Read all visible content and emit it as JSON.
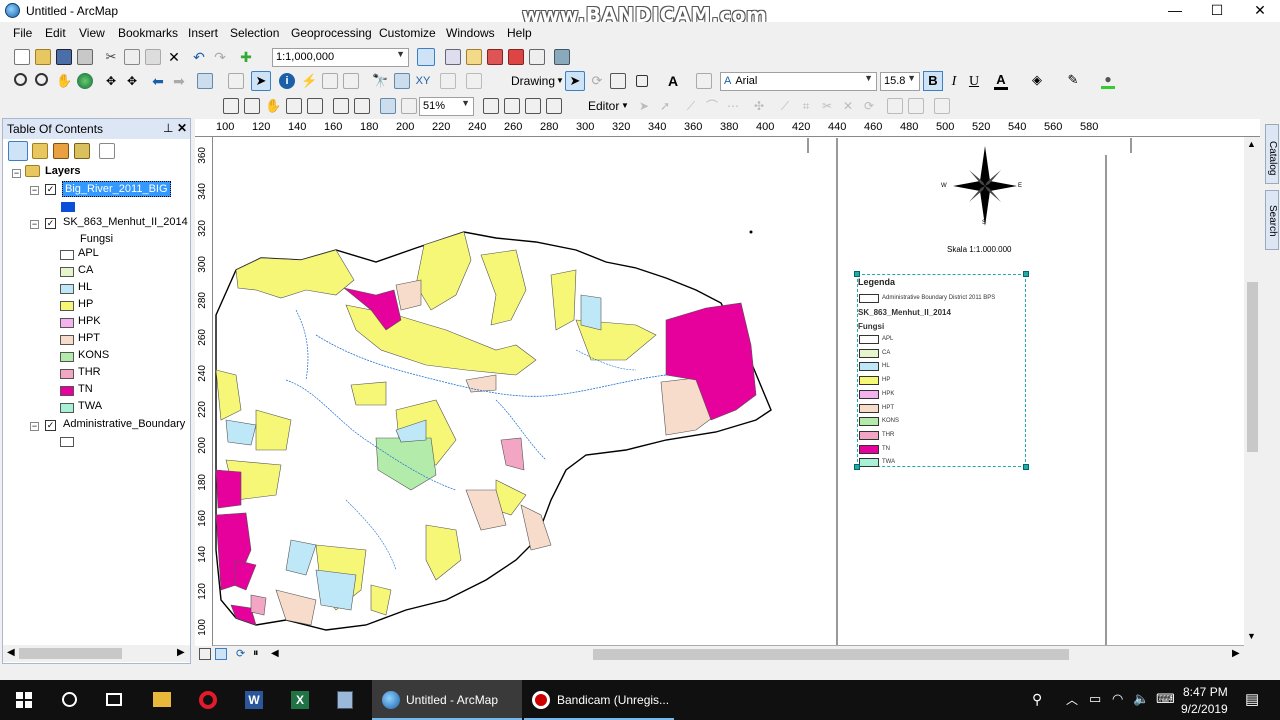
{
  "window": {
    "title": "Untitled - ArcMap",
    "watermark": "www.BANDICAM.com",
    "min": "—",
    "max": "☐",
    "close": "✕"
  },
  "menu": [
    "File",
    "Edit",
    "View",
    "Bookmarks",
    "Insert",
    "Selection",
    "Geoprocessing",
    "Customize",
    "Windows",
    "Help"
  ],
  "toolbar": {
    "scale": "1:1,000,000",
    "drawing_label": "Drawing",
    "font": "Arial",
    "font_size": "15.8",
    "bold": "B",
    "italic": "I",
    "underline": "U",
    "zoom": "51%",
    "editor": "Editor"
  },
  "toc": {
    "title": "Table Of Contents",
    "root": "Layers",
    "layers": [
      {
        "name": "Big_River_2011_BIG",
        "checked": true,
        "selected": true
      },
      {
        "name": "SK_863_Menhut_II_2014",
        "checked": true,
        "field": "Fungsi",
        "classes": [
          {
            "label": "APL",
            "color": "#ffffff"
          },
          {
            "label": "CA",
            "color": "#e6f5cc"
          },
          {
            "label": "HL",
            "color": "#bee8f7"
          },
          {
            "label": "HP",
            "color": "#f7f777"
          },
          {
            "label": "HPK",
            "color": "#f4b2ee"
          },
          {
            "label": "HPT",
            "color": "#f7dccc"
          },
          {
            "label": "KONS",
            "color": "#b3ebaa"
          },
          {
            "label": "THR",
            "color": "#f2a6c3"
          },
          {
            "label": "TN",
            "color": "#e6009c"
          },
          {
            "label": "TWA",
            "color": "#a8f0d6"
          }
        ]
      },
      {
        "name": "Administrative_Boundary",
        "checked": true
      }
    ]
  },
  "ruler": {
    "x": [
      "100",
      "120",
      "140",
      "160",
      "180",
      "200",
      "220",
      "240",
      "260",
      "280",
      "300",
      "320",
      "340",
      "360",
      "380",
      "400",
      "420",
      "440",
      "460",
      "480",
      "500",
      "520",
      "540",
      "560",
      "580"
    ],
    "y": [
      "360",
      "340",
      "320",
      "300",
      "280",
      "260",
      "240",
      "220",
      "200",
      "180",
      "160",
      "140",
      "120",
      "100"
    ]
  },
  "layout": {
    "compass": {
      "n": "N",
      "s": "S",
      "w": "W",
      "e": "E"
    },
    "scale_text": "Skala 1:1.000.000",
    "legend": {
      "title": "Legenda",
      "admin": "Administrative Boundary District 2011 BPS",
      "layer": "SK_863_Menhut_II_2014",
      "field": "Fungsi",
      "items": [
        "APL",
        "CA",
        "HL",
        "HP",
        "HPK",
        "HPT",
        "KONS",
        "THR",
        "TN",
        "TWA"
      ]
    }
  },
  "side_tabs": [
    "Catalog",
    "Search"
  ],
  "taskbar": {
    "arcmap": "Untitled - ArcMap",
    "bandicam": "Bandicam (Unregis...",
    "time": "8:47 PM",
    "date": "9/2/2019"
  }
}
